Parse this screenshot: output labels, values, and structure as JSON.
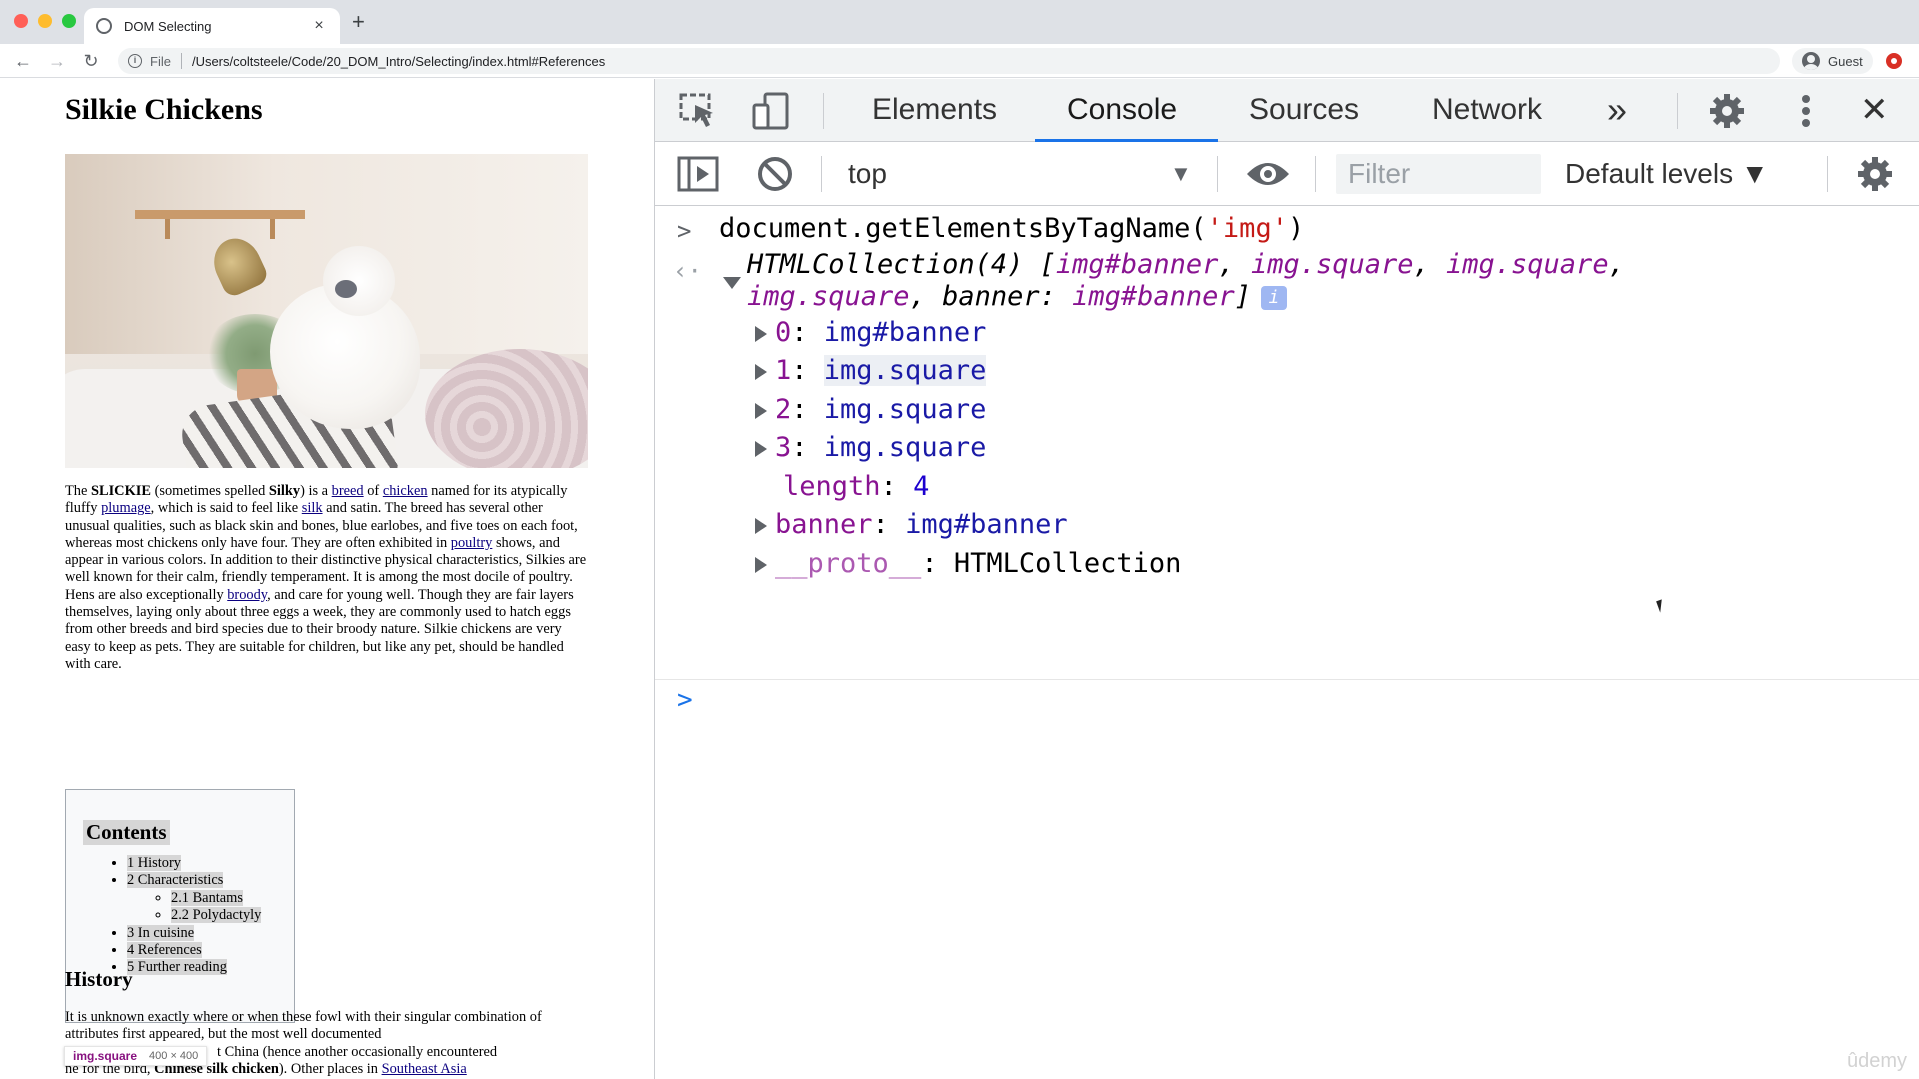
{
  "browser": {
    "tab_title": "DOM Selecting",
    "tab_close": "×",
    "new_tab": "+",
    "address_scheme": "File",
    "address_url": "/Users/coltsteele/Code/20_DOM_Intro/Selecting/index.html#References",
    "profile_label": "Guest",
    "icons": [
      "back-arrow-icon",
      "forward-arrow-icon",
      "reload-icon",
      "info-icon",
      "guest-avatar-icon",
      "extension-icon"
    ]
  },
  "page": {
    "title": "Silkie Chickens",
    "intro": {
      "t1": "The ",
      "b1": "SLICKIE",
      "t2": " (sometimes spelled ",
      "b2": "Silky",
      "t3": ") is a ",
      "link_breed": "breed",
      "t4": " of ",
      "link_chicken": "chicken",
      "t5": " named for its atypically fluffy ",
      "link_plumage": "plumage",
      "t6": ", which is said to feel like ",
      "link_silk": "silk",
      "t7": " and satin. The breed has several other unusual qualities, such as black skin and bones, blue earlobes, and five toes on each foot, whereas most chickens only have four. They are often exhibited in ",
      "link_poultry": "poultry",
      "t8": " shows, and appear in various colors. In addition to their distinctive physical characteristics, Silkies are well known for their calm, friendly temperament. It is among the most docile of poultry. Hens are also exceptionally ",
      "link_broody": "broody",
      "t9": ", and care for young well. Though they are fair layers themselves, laying only about three eggs a week, they are commonly used to hatch eggs from other breeds and bird species due to their broody nature. Silkie chickens are very easy to keep as pets. They are suitable for children, but like any pet, should be handled with care."
    },
    "toc": {
      "title": "Contents",
      "items": [
        "1 History",
        "2 Characteristics",
        "2.1 Bantams",
        "2.2 Polydactyly",
        "3 In cuisine",
        "4 References",
        "5 Further reading"
      ]
    },
    "history": {
      "heading": "History",
      "t1": "It is unknown exactly where or when these fowl with their singular combination of attributes first appeared, but the most well documented ",
      "t2": "t China (hence another occasionally encountered ",
      "t3": "n",
      "t4": "e for the bird, ",
      "b1": "Chinese silk chicken",
      "t5": "). Other places in ",
      "link_sea": "Southeast Asia"
    },
    "inspect_tooltip": {
      "name": "img.square",
      "size": "400 × 400"
    }
  },
  "devtools": {
    "tabs": [
      "Elements",
      "Console",
      "Sources",
      "Network"
    ],
    "active_tab": "Console",
    "more_tabs": "»",
    "close": "✕",
    "context": "top",
    "filter_placeholder": "Filter",
    "levels": "Default levels ▼",
    "console": {
      "input_cmd_a": "document.getElementsByTagName(",
      "input_cmd_str": "'img'",
      "input_cmd_b": ")",
      "result_head": "HTMLCollection(4) [",
      "result_items": [
        "img#banner",
        "img.square",
        "img.square",
        "img.square"
      ],
      "result_named_key": "banner",
      "result_named_val": "img#banner",
      "result_close": "]",
      "info_badge": "i",
      "entries": [
        {
          "key": "0",
          "val": "img#banner"
        },
        {
          "key": "1",
          "val": "img.square"
        },
        {
          "key": "2",
          "val": "img.square"
        },
        {
          "key": "3",
          "val": "img.square"
        }
      ],
      "length_key": "length",
      "length_val": "4",
      "banner_key": "banner",
      "banner_val": "img#banner",
      "proto_key": "__proto__",
      "proto_val": "HTMLCollection",
      "sep": ", ",
      "colon": ": "
    }
  },
  "watermark": "ûdemy",
  "colors": {
    "active_tab_underline": "#1a73e8",
    "link": "#0b0080",
    "console_prop": "#881391",
    "console_string": "#c41a16",
    "console_value": "#1a1aa6"
  }
}
